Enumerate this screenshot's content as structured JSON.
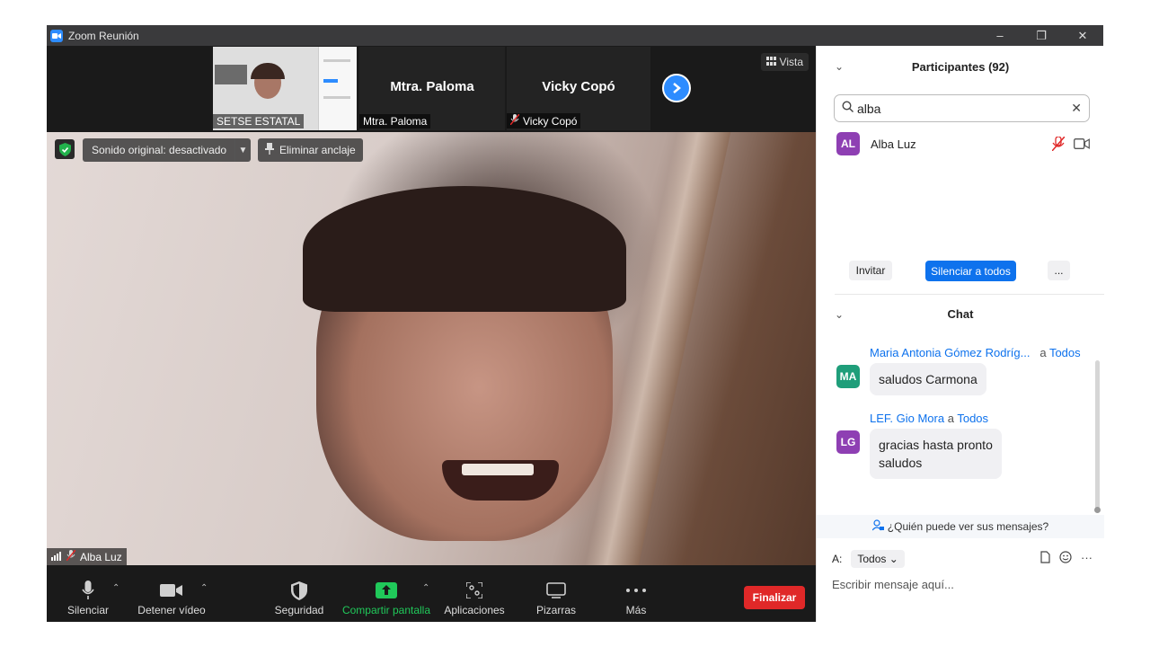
{
  "window": {
    "title": "Zoom Reunión",
    "minimize": "–",
    "restore": "❐",
    "close": "✕"
  },
  "gallery": {
    "tiles": [
      {
        "label": "SETSE ESTATAL"
      },
      {
        "name": "Mtra. Paloma",
        "label": "Mtra. Paloma"
      },
      {
        "name": "Vicky Copó",
        "label": "Vicky Copó"
      }
    ],
    "view_label": "Vista"
  },
  "video_toolbar": {
    "sound_label": "Sonido original: desactivado",
    "unpin_label": "Eliminar anclaje"
  },
  "main_video": {
    "name": "Alba Luz"
  },
  "controls": {
    "mute": "Silenciar",
    "stop_video": "Detener vídeo",
    "security": "Seguridad",
    "share": "Compartir pantalla",
    "apps": "Aplicaciones",
    "whiteboards": "Pizarras",
    "more": "Más",
    "end": "Finalizar"
  },
  "participants": {
    "title": "Participantes (92)",
    "search_value": "alba",
    "list": [
      {
        "initials": "AL",
        "name": "Alba Luz",
        "avatar_color": "#8e3fb3"
      }
    ],
    "invite": "Invitar",
    "mute_all": "Silenciar a todos",
    "more": "..."
  },
  "chat": {
    "title": "Chat",
    "messages": [
      {
        "initials": "MA",
        "avatar_color": "#1f9e7a",
        "from": "Maria Antonia Gómez Rodríg...",
        "to_word": "a",
        "to": "Todos",
        "text": "saludos Carmona"
      },
      {
        "initials": "LG",
        "avatar_color": "#8e3fb3",
        "from": "LEF. Gio Mora",
        "to_word": "a",
        "to": "Todos",
        "text_line1": "gracias hasta pronto",
        "text_line2": "saludos"
      }
    ],
    "who_can_see": "¿Quién puede ver sus mensajes?",
    "to_label": "A:",
    "to_value": "Todos ⌄",
    "placeholder": "Escribir mensaje aquí..."
  },
  "colors": {
    "accent": "#0e72ed",
    "share_green": "#20c95a",
    "end_red": "#e02828"
  }
}
